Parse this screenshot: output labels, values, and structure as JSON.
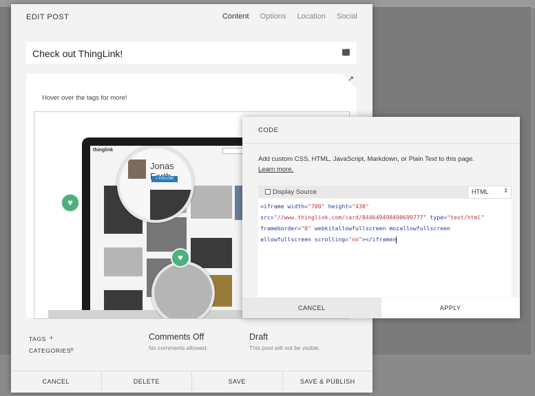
{
  "edit_post": {
    "title": "EDIT POST",
    "tabs": [
      {
        "label": "Content"
      },
      {
        "label": "Options"
      },
      {
        "label": "Location"
      },
      {
        "label": "Social"
      }
    ],
    "post_title": "Check out ThingLink!",
    "content": {
      "hover_text": "Hover over the tags for more!",
      "embed": {
        "logo_text": "thinglink",
        "profile_name": "Jonas Forth",
        "follow_label": "+ FOLLOW"
      }
    },
    "meta": {
      "tags_label": "TAGS",
      "categories_label": "CATEGORIES",
      "comments_heading": "Comments Off",
      "comments_sub": "No comments allowed.",
      "status_heading": "Draft",
      "status_sub": "This post will not be visible."
    },
    "footer": {
      "cancel": "CANCEL",
      "delete": "DELETE",
      "save": "SAVE",
      "save_publish": "SAVE & PUBLISH"
    }
  },
  "code_dialog": {
    "title": "CODE",
    "description": "Add custom CSS, HTML, JavaScript, Markdown, or Plain Text to this page.",
    "learn_more": "Learn more.",
    "display_source_label": "Display Source",
    "language": "HTML",
    "code_lines": [
      {
        "a": "<iframe width=",
        "b": "\"700\"",
        "c": " height=",
        "d": "\"438\""
      },
      {
        "a": "src=",
        "b": "\"//www.thinglink.com/card/844649498490699777\"",
        "c": " type=",
        "d": "\"text/html\""
      },
      {
        "a": "frameborder=",
        "b": "\"0\"",
        "c": " webkitallowfullscreen mozallowfullscreen",
        "d": ""
      },
      {
        "a": "allowfullscreen scrolling=",
        "b": "\"no\"",
        "c": "></iframe>",
        "d": ""
      }
    ],
    "cancel": "CANCEL",
    "apply": "APPLY"
  },
  "icons": {
    "heart": "heart-icon",
    "expand": "expand-arrow-icon",
    "plus": "plus-icon",
    "text_options": "text-options-icon"
  },
  "colors": {
    "tag_green": "#4db07b",
    "follow_blue": "#2a7ab8",
    "code_attr": "#283a8f",
    "code_string": "#b8343a"
  }
}
